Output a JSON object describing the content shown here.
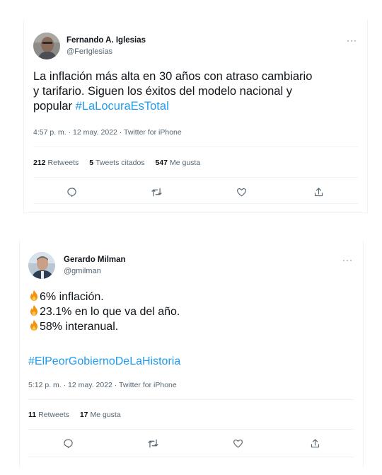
{
  "tweets": [
    {
      "author_name": "Fernando A. Iglesias",
      "handle": "@FerIglesias",
      "more_label": "···",
      "text_line1": "La inflación más alta en 30 años con atraso cambiario",
      "text_line2": "y tarifario. Siguen los éxitos del modelo nacional y",
      "text_line3_prefix": "popular ",
      "hashtag": "#LaLocuraEsTotal",
      "timestamp": "4:57 p. m. · 12 may. 2022 · Twitter for iPhone",
      "retweets_count": "212",
      "retweets_label": "Retweets",
      "quotes_count": "5",
      "quotes_label": "Tweets citados",
      "likes_count": "547",
      "likes_label": "Me gusta",
      "actions": [
        "reply-icon",
        "retweet-icon",
        "like-icon",
        "share-icon"
      ]
    },
    {
      "author_name": "Gerardo Milman",
      "handle": "@gmilman",
      "more_label": "···",
      "line1": "6% inflación.",
      "line2": "23.1% en lo que va del año.",
      "line3": "58% interanual.",
      "hashtag": "#ElPeorGobiernoDeLaHistoria",
      "timestamp": "5:12 p. m. · 12 may. 2022 · Twitter for iPhone",
      "retweets_count": "11",
      "retweets_label": "Retweets",
      "likes_count": "17",
      "likes_label": "Me gusta",
      "actions": [
        "reply-icon",
        "retweet-icon",
        "like-icon",
        "share-icon"
      ]
    }
  ],
  "colors": {
    "text": "#0f1419",
    "secondary": "#536471",
    "link": "#1d9bf0",
    "divider": "#eff3f4"
  }
}
